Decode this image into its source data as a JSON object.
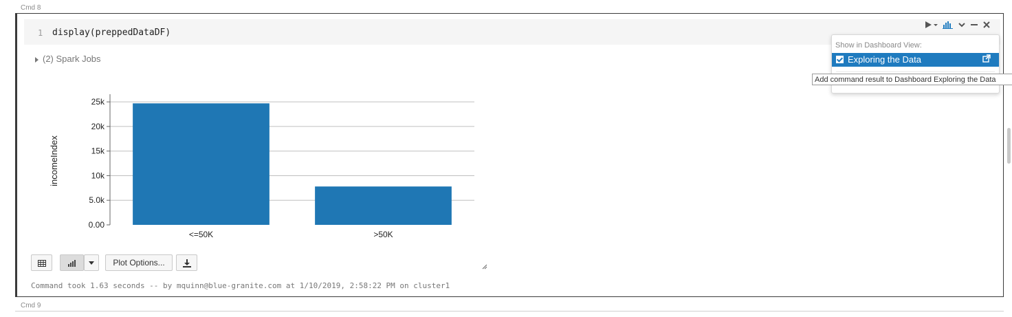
{
  "cells": {
    "cmd8_label": "Cmd 8",
    "cmd9_label": "Cmd 9"
  },
  "code": {
    "line_number": "1",
    "text": "display(preppedDataDF)"
  },
  "spark_jobs": "(2) Spark Jobs",
  "toolbar": {
    "run_icon": "run-icon",
    "chart_icon": "bar-chart-icon",
    "menu_icon": "chevron-down-icon",
    "minimize_icon": "minimize-icon",
    "close_icon": "close-icon"
  },
  "dashboard_menu": {
    "title": "Show in Dashboard View:",
    "item_label": "Exploring the Data",
    "item_checked": true,
    "tooltip": "Add command result to Dashboard Exploring the Data"
  },
  "chart_data": {
    "type": "bar",
    "categories": [
      "<=50K",
      ">50K"
    ],
    "values": [
      24700,
      7800
    ],
    "ylabel": "incomeIndex",
    "xlabel": "",
    "ylim": [
      0,
      26000
    ],
    "yticks": [
      {
        "value": 0,
        "label": "0.00"
      },
      {
        "value": 5000,
        "label": "5.0k"
      },
      {
        "value": 10000,
        "label": "10k"
      },
      {
        "value": 15000,
        "label": "15k"
      },
      {
        "value": 20000,
        "label": "20k"
      },
      {
        "value": 25000,
        "label": "25k"
      }
    ],
    "grid": true,
    "color": "#1f77b4"
  },
  "buttons": {
    "table_icon": "table-icon",
    "chart_icon": "bar-chart-icon",
    "dropdown_icon": "caret-down-icon",
    "plot_options": "Plot Options...",
    "download_icon": "download-icon"
  },
  "footer": "Command took 1.63 seconds -- by mquinn@blue-granite.com at 1/10/2019, 2:58:22 PM on cluster1"
}
